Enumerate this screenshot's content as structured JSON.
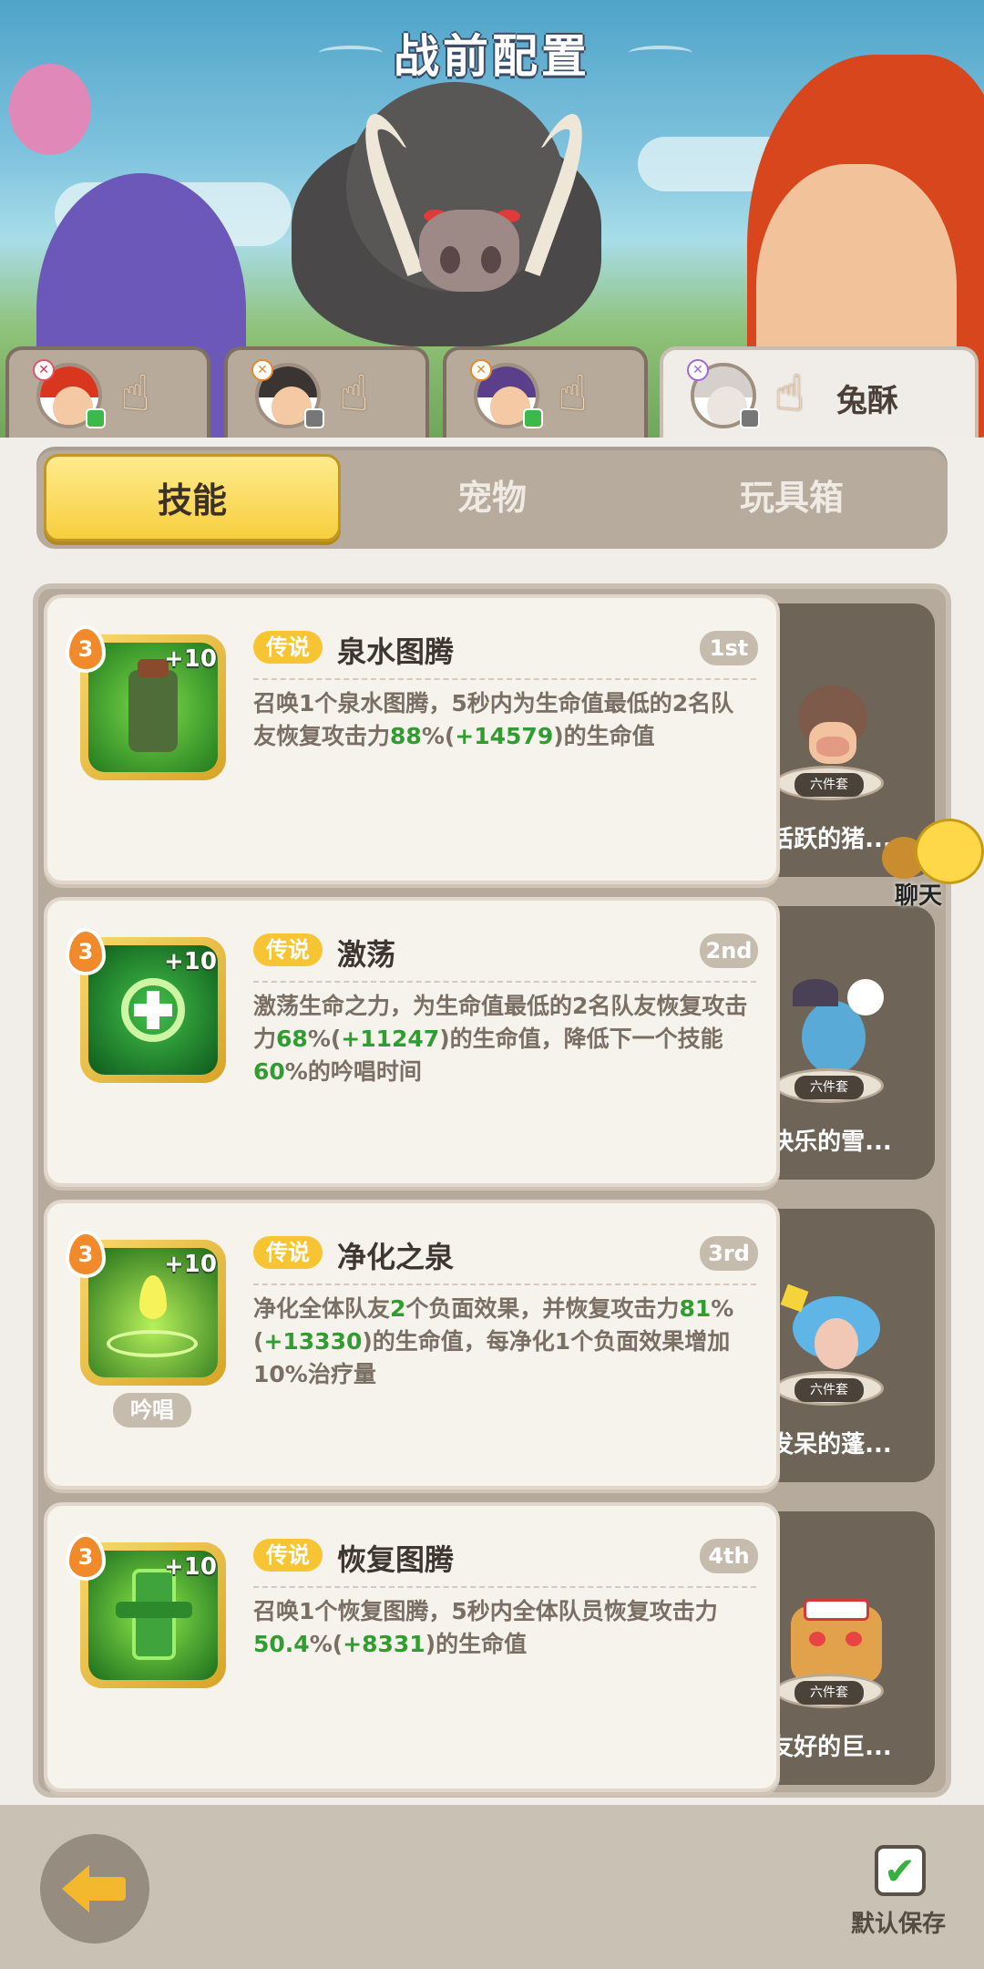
{
  "title": "战前配置",
  "hero_tabs": [
    {
      "avatar": "hero-red-hair-avatar",
      "status": "online",
      "name": ""
    },
    {
      "avatar": "hero-dark-hair-avatar",
      "status": "offline",
      "name": ""
    },
    {
      "avatar": "hero-bandana-avatar",
      "status": "online",
      "name": ""
    },
    {
      "avatar": "hero-silver-hair-avatar",
      "status": "offline",
      "name": "兔酥"
    }
  ],
  "tabs": {
    "skills": "技能",
    "pets": "宠物",
    "toybox": "玩具箱"
  },
  "skills": [
    {
      "level": "3",
      "plus": "+10",
      "rarity": "传说",
      "name": "泉水图腾",
      "order": "1st",
      "desc_parts": [
        "召唤1个泉水图腾，5秒内为生命值最低的2名队友恢复攻击力",
        "88",
        "%(",
        "+14579",
        ")的生命值"
      ],
      "chant": "",
      "pet": {
        "name": "活跃的猪...",
        "set": "六件套"
      }
    },
    {
      "level": "3",
      "plus": "+10",
      "rarity": "传说",
      "name": "激荡",
      "order": "2nd",
      "desc_parts": [
        "激荡生命之力，为生命值最低的2名队友恢复攻击力",
        "68",
        "%(",
        "+11247",
        ")的生命值，降低下一个技能",
        "60",
        "%的吟唱时间"
      ],
      "chant": "",
      "pet": {
        "name": "快乐的雪...",
        "set": "六件套"
      }
    },
    {
      "level": "3",
      "plus": "+10",
      "rarity": "传说",
      "name": "净化之泉",
      "order": "3rd",
      "desc_parts": [
        "净化全体队友",
        "2",
        "个负面效果，并恢复攻击力",
        "81",
        "%(",
        "+13330",
        ")的生命值，每净化1个负面效果增加10%治疗量"
      ],
      "chant": "吟唱",
      "pet": {
        "name": "发呆的蓬...",
        "set": "六件套"
      }
    },
    {
      "level": "3",
      "plus": "+10",
      "rarity": "传说",
      "name": "恢复图腾",
      "order": "4th",
      "desc_parts": [
        "召唤1个恢复图腾，5秒内全体队员恢复攻击力",
        "50.4",
        "%(",
        "+8331",
        ")的生命值"
      ],
      "chant": "",
      "pet": {
        "name": "友好的巨...",
        "set": "六件套"
      }
    }
  ],
  "chat": {
    "label": "聊天"
  },
  "footer": {
    "save_label": "默认保存",
    "save_checked": true
  },
  "colors": {
    "accent": "#f7cf3d",
    "highlight": "#2f9d2f",
    "rarity": "#f7c434"
  }
}
